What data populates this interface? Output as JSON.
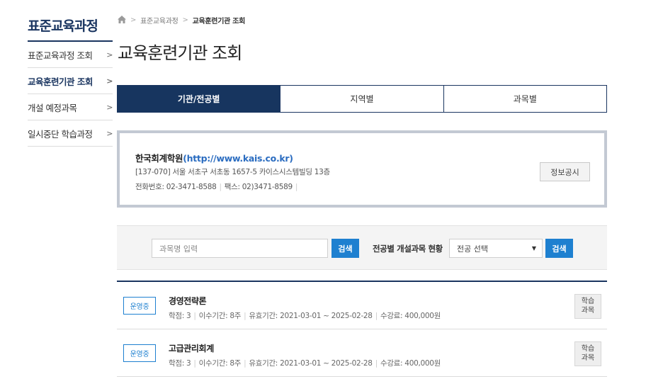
{
  "sidebar": {
    "title": "표준교육과정",
    "items": [
      {
        "label": "표준교육과정 조회",
        "active": false
      },
      {
        "label": "교육훈련기관 조회",
        "active": true
      },
      {
        "label": "개설 예정과목",
        "active": false
      },
      {
        "label": "일시중단 학습과정",
        "active": false
      }
    ],
    "chevron": ">"
  },
  "breadcrumb": {
    "home_icon": "home-icon",
    "separator": ">",
    "items": [
      "표준교육과정",
      "교육훈련기관 조회"
    ]
  },
  "page_title": "교육훈련기관 조회",
  "tabs": [
    {
      "label": "기관/전공별",
      "active": true
    },
    {
      "label": "지역별",
      "active": false
    },
    {
      "label": "과목별",
      "active": false
    }
  ],
  "institution": {
    "name": "한국회계학원",
    "url": "(http://www.kais.co.kr)",
    "address": "[137-070] 서울 서초구 서초동 1657-5 카이스시스템빌딩 13층",
    "phone": "전화번호: 02-3471-8588",
    "fax": "팩스: 02)3471-8589",
    "info_button": "정보공시"
  },
  "search": {
    "placeholder": "과목명 입력",
    "search_button": "검색",
    "major_label": "전공별 개설과목 현황",
    "major_select": "전공 선택",
    "major_search_button": "검색"
  },
  "courses": [
    {
      "status": "운영중",
      "title": "경영전략론",
      "credit": "학점: 3",
      "period": "이수기간: 8주",
      "valid": "유효기간: 2021-03-01 ~ 2025-02-28",
      "fee": "수강료: 400,000원",
      "button_line1": "학습",
      "button_line2": "과목"
    },
    {
      "status": "운영중",
      "title": "고급관리회계",
      "credit": "학점: 3",
      "period": "이수기간: 8주",
      "valid": "유효기간: 2021-03-01 ~ 2025-02-28",
      "fee": "수강료: 400,000원",
      "button_line1": "학습",
      "button_line2": "과목"
    }
  ],
  "colors": {
    "primary": "#17355f",
    "accent": "#1e80d0",
    "link": "#2a6cc0"
  }
}
